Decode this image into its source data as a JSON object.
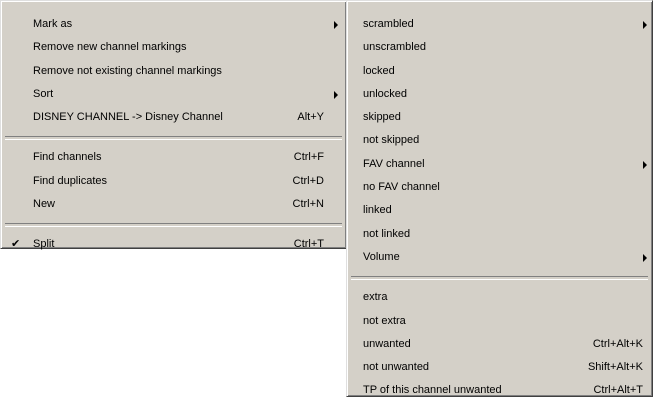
{
  "main_menu": {
    "items": [
      {
        "label": "Mark as",
        "shortcut": "",
        "submenu": true
      },
      {
        "label": "Remove new channel markings",
        "shortcut": "",
        "submenu": false
      },
      {
        "label": "Remove not existing channel markings",
        "shortcut": "",
        "submenu": false
      },
      {
        "label": "Sort",
        "shortcut": "",
        "submenu": true
      },
      {
        "label": "DISNEY CHANNEL -> Disney Channel",
        "shortcut": "Alt+Y",
        "submenu": false
      },
      {
        "label": "Find channels",
        "shortcut": "Ctrl+F",
        "submenu": false
      },
      {
        "label": "Find duplicates",
        "shortcut": "Ctrl+D",
        "submenu": false
      },
      {
        "label": "New",
        "shortcut": "Ctrl+N",
        "submenu": false
      },
      {
        "label": "Split",
        "shortcut": "Ctrl+T",
        "checked": true,
        "check_glyph": "✔"
      }
    ]
  },
  "sub_menu": {
    "items": [
      {
        "label": "scrambled",
        "shortcut": "",
        "submenu": true
      },
      {
        "label": "unscrambled",
        "shortcut": ""
      },
      {
        "label": "locked",
        "shortcut": ""
      },
      {
        "label": "unlocked",
        "shortcut": ""
      },
      {
        "label": "skipped",
        "shortcut": ""
      },
      {
        "label": "not skipped",
        "shortcut": ""
      },
      {
        "label": "FAV channel",
        "shortcut": "",
        "submenu": true
      },
      {
        "label": "no FAV channel",
        "shortcut": ""
      },
      {
        "label": "linked",
        "shortcut": ""
      },
      {
        "label": "not linked",
        "shortcut": ""
      },
      {
        "label": "Volume",
        "shortcut": "",
        "submenu": true
      },
      {
        "label": "extra",
        "shortcut": ""
      },
      {
        "label": "not extra",
        "shortcut": ""
      },
      {
        "label": "unwanted",
        "shortcut": "Ctrl+Alt+K"
      },
      {
        "label": "not unwanted",
        "shortcut": "Shift+Alt+K"
      },
      {
        "label": "TP of this channel unwanted",
        "shortcut": "Ctrl+Alt+T"
      }
    ]
  },
  "colors": {
    "menu_face": "#d4d0c8",
    "separator_dark": "#808080",
    "separator_light": "#ffffff",
    "text": "#000000"
  },
  "icons": {
    "submenu_arrow": "chevron-right-icon",
    "check": "checkmark-icon"
  }
}
